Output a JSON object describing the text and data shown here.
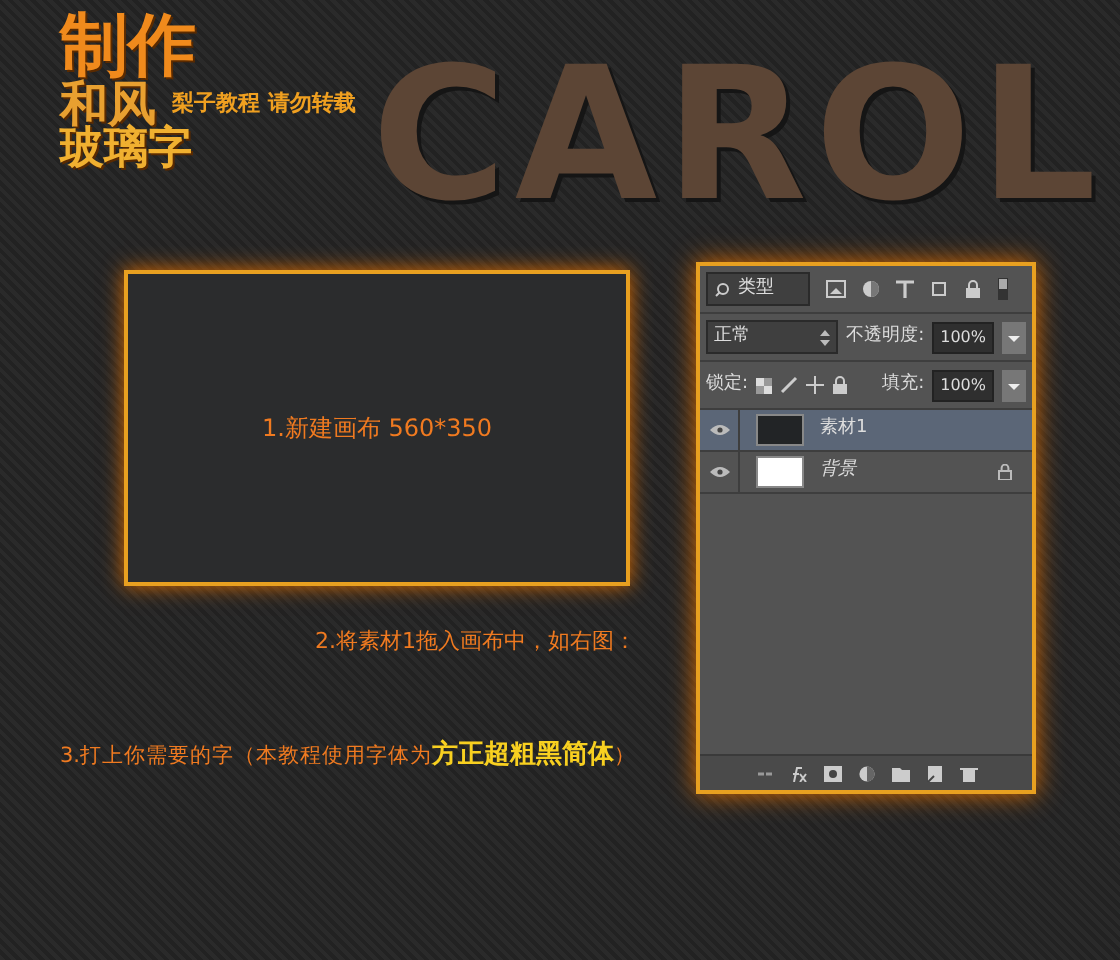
{
  "header": {
    "title_lines": [
      "制作",
      "和风",
      "玻璃字"
    ],
    "subtitle": "梨子教程 请勿转载",
    "banner_text": "CAROL"
  },
  "canvas": {
    "caption": "1.新建画布 560*350"
  },
  "steps": [
    {
      "text": "2.将素材1拖入画布中，如右图："
    },
    {
      "text": "3.打上你需要的字（本教程使用字体为**方正超粗黑简体**）"
    }
  ],
  "layers_panel": {
    "filter": "类型",
    "blend_mode": "正常",
    "opacity_label": "不透明度:",
    "opacity": "100%",
    "lock_label": "锁定:",
    "fill_label": "填充:",
    "fill": "100%",
    "layers": [
      {
        "name": "素材1",
        "selected": true,
        "locked": false,
        "kind": "dark"
      },
      {
        "name": "背景",
        "selected": false,
        "locked": true,
        "kind": "white"
      }
    ]
  }
}
